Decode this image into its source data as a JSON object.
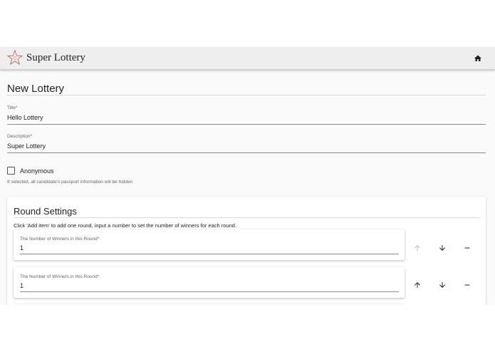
{
  "app": {
    "title": "Super Lottery"
  },
  "page": {
    "title": "New Lottery"
  },
  "form": {
    "title_field": {
      "label": "Title",
      "required_mark": "*",
      "value": "Hello Lottery"
    },
    "description_field": {
      "label": "Description",
      "required_mark": "*",
      "value": "Super Lottery"
    },
    "anonymous": {
      "label": "Anonymous",
      "checked": false,
      "helper": "If selected, all candidate's passport information will be hidden"
    }
  },
  "rounds_card": {
    "title": "Round Settings",
    "description": "Click 'Add item' to add one round, input a number to set the number of winners for each round.",
    "rounds": [
      {
        "label": "The Number of Winners in this Round",
        "required_mark": "*",
        "value": "1",
        "move_up_enabled": false
      },
      {
        "label": "The Number of Winners in this Round",
        "required_mark": "*",
        "value": "1",
        "move_up_enabled": true
      }
    ]
  },
  "icons": {
    "logo": "star-logo-icon",
    "home": "home-icon",
    "up": "arrow-up-icon",
    "down": "arrow-down-icon",
    "remove": "minus-icon"
  },
  "colors": {
    "appbar_bg": "#eeeeee",
    "background": "#fafafa",
    "icon": "#212121",
    "icon_disabled": "#bdbdbd"
  }
}
